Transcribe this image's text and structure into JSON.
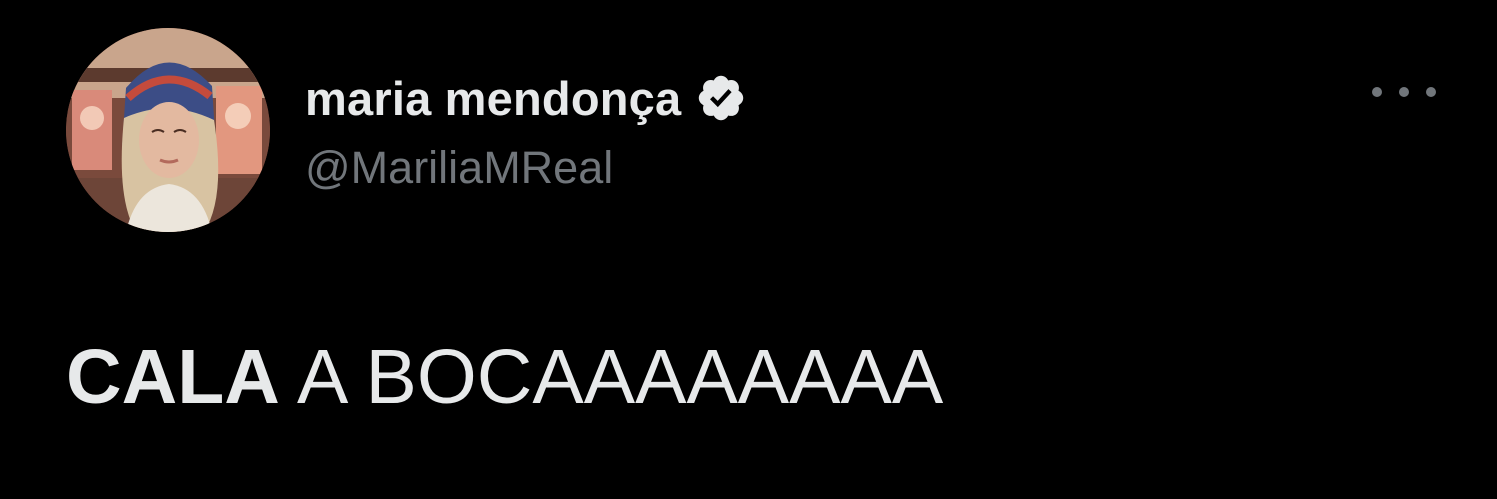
{
  "tweet": {
    "author": {
      "display_name": "maria mendonça",
      "handle": "@MariliaMReal",
      "verified": true,
      "avatar_icon": "profile-photo"
    },
    "more_icon": "more-options-icon",
    "text_bold": "CALA",
    "text_rest": " A BOCAAAAAAAA"
  },
  "colors": {
    "background": "#000000",
    "primary_text": "#e7e9ea",
    "secondary_text": "#71767b",
    "verified_badge": "#e7e9ea"
  }
}
